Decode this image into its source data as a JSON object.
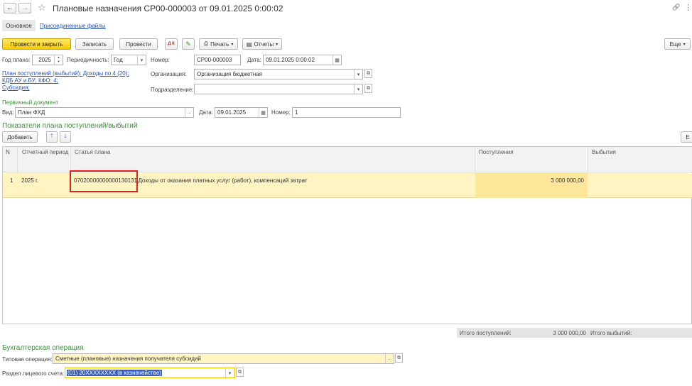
{
  "window": {
    "title": "Плановые назначения СР00-000003 от 09.01.2025 0:00:02",
    "back_glyph": "←",
    "forward_glyph": "→",
    "star_glyph": "☆",
    "link_glyph": "🔗",
    "more_glyph": "⋮",
    "close_glyph": "×"
  },
  "tabs": [
    {
      "label": "Основное"
    },
    {
      "label": "Присоединенные файлы"
    }
  ],
  "toolbar": {
    "post_close_label": "Провести и закрыть",
    "save_label": "Записать",
    "post_label": "Провести",
    "print_label": "Печать",
    "reports_label": "Отчеты",
    "more_label": "Еще"
  },
  "form": {
    "year_label": "Год плана:",
    "year_value": "2025",
    "period_label": "Периодичность:",
    "period_value": "Год",
    "number_label": "Номер:",
    "number_value": "СР00-000003",
    "date_label": "Дата:",
    "date_value": "09.01.2025  0:00:02",
    "plan_link_line1": "План поступлений (выбытий): Доходы по 4 (20);",
    "plan_link_line2": "КДБ АУ и БУ; КФО: 4;",
    "plan_link_line3": "Субсидия;",
    "org_label": "Организация:",
    "org_value": "Организация бюджетная",
    "dept_label": "Подразделение:",
    "dept_value": ""
  },
  "primary_doc": {
    "section_title": "Первичный документ",
    "type_label": "Вид:",
    "type_value": "План ФХД",
    "date_label": "Дата:",
    "date_value": "09.01.2025",
    "number_label": "Номер:",
    "number_value": "1"
  },
  "indicators": {
    "section_title": "Показатели плана поступлений/выбытий",
    "add_label": "Добавить",
    "more_cut_label": "Е",
    "columns": [
      "N",
      "Отчетный период",
      "Статья плана",
      "Поступления",
      "Выбытия"
    ],
    "rows": [
      {
        "n": "1",
        "period": "2025 г.",
        "code": "07020000000000130131",
        "description": ", Доходы от оказания платных услуг (работ), компенсаций затрат",
        "income": "3 000 000,00",
        "expense": ""
      }
    ],
    "total_income_label": "Итого поступлений:",
    "total_income_value": "3 000 000,00",
    "total_expense_label": "Итого выбытий:"
  },
  "accounting": {
    "section_title": "Бухгалтерская операция",
    "op_label": "Типовая операция:",
    "op_value": "Сметные (плановые) назначения получателя субсидий",
    "account_label": "Раздел лицевого счета:",
    "account_value": "(01) 20ХХХХХХХХ (в казначействе)"
  },
  "colors": {
    "accent_yellow": "#f5c800",
    "row_highlight": "#fff4c2",
    "income_cell": "#fde79a",
    "highlight_box": "#e0201b",
    "link": "#2a55b0",
    "section_green": "#3e8f3e"
  }
}
